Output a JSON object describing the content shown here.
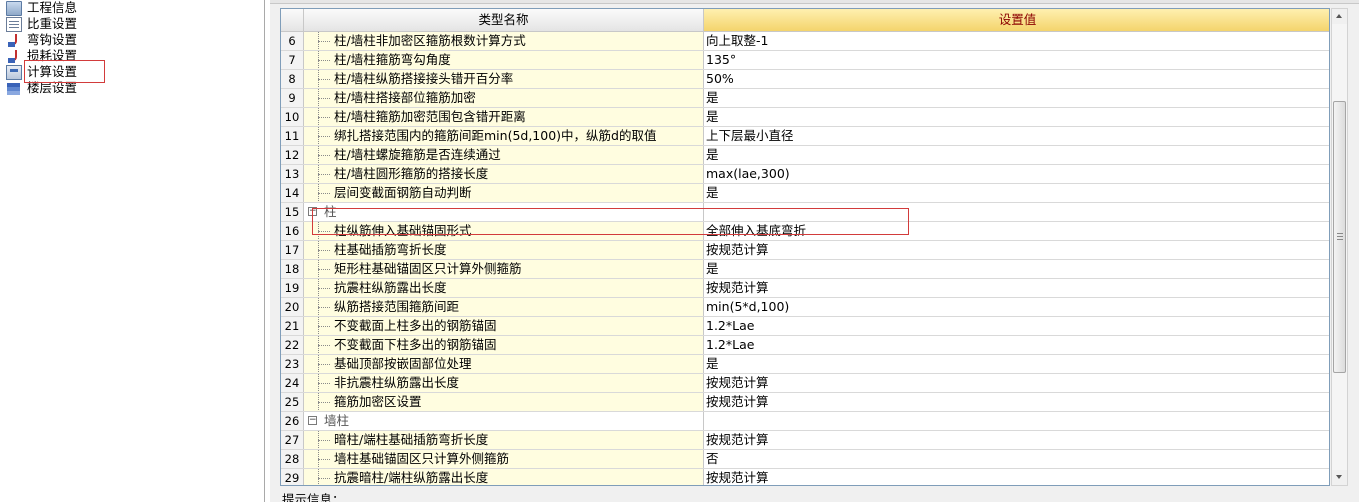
{
  "nav": {
    "items": [
      {
        "label": "工程信息",
        "icon": "folder-icon"
      },
      {
        "label": "比重设置",
        "icon": "document-icon"
      },
      {
        "label": "弯钩设置",
        "icon": "hook-icon"
      },
      {
        "label": "损耗设置",
        "icon": "chart-icon"
      },
      {
        "label": "计算设置",
        "icon": "calculator-icon"
      },
      {
        "label": "楼层设置",
        "icon": "layers-icon"
      }
    ],
    "selected": "计算设置"
  },
  "grid": {
    "columns": {
      "name": "类型名称",
      "value": "设置值"
    },
    "rows": [
      {
        "num": "6",
        "name": "柱/墙柱非加密区箍筋根数计算方式",
        "value": "向上取整-1"
      },
      {
        "num": "7",
        "name": "柱/墙柱箍筋弯勾角度",
        "value": "135°"
      },
      {
        "num": "8",
        "name": "柱/墙柱纵筋搭接接头错开百分率",
        "value": "50%"
      },
      {
        "num": "9",
        "name": "柱/墙柱搭接部位箍筋加密",
        "value": "是"
      },
      {
        "num": "10",
        "name": "柱/墙柱箍筋加密范围包含错开距离",
        "value": "是"
      },
      {
        "num": "11",
        "name": "绑扎搭接范围内的箍筋间距min(5d,100)中，纵筋d的取值",
        "value": "上下层最小直径"
      },
      {
        "num": "12",
        "name": "柱/墙柱螺旋箍筋是否连续通过",
        "value": "是"
      },
      {
        "num": "13",
        "name": "柱/墙柱圆形箍筋的搭接长度",
        "value": "max(lae,300)"
      },
      {
        "num": "14",
        "name": "层间变截面钢筋自动判断",
        "value": "是"
      },
      {
        "num": "15",
        "group": "柱",
        "expander": "−"
      },
      {
        "num": "16",
        "name": "柱纵筋伸入基础锚固形式",
        "value": "全部伸入基底弯折"
      },
      {
        "num": "17",
        "name": "柱基础插筋弯折长度",
        "value": "按规范计算"
      },
      {
        "num": "18",
        "name": "矩形柱基础锚固区只计算外侧箍筋",
        "value": "是"
      },
      {
        "num": "19",
        "name": "抗震柱纵筋露出长度",
        "value": "按规范计算"
      },
      {
        "num": "20",
        "name": "纵筋搭接范围箍筋间距",
        "value": "min(5*d,100)"
      },
      {
        "num": "21",
        "name": "不变截面上柱多出的钢筋锚固",
        "value": "1.2*Lae"
      },
      {
        "num": "22",
        "name": "不变截面下柱多出的钢筋锚固",
        "value": "1.2*Lae"
      },
      {
        "num": "23",
        "name": "基础顶部按嵌固部位处理",
        "value": "是"
      },
      {
        "num": "24",
        "name": "非抗震柱纵筋露出长度",
        "value": "按规范计算"
      },
      {
        "num": "25",
        "name": "箍筋加密区设置",
        "value": "按规范计算"
      },
      {
        "num": "26",
        "group": "墙柱",
        "expander": "−"
      },
      {
        "num": "27",
        "name": "暗柱/端柱基础插筋弯折长度",
        "value": "按规范计算"
      },
      {
        "num": "28",
        "name": "墙柱基础锚固区只计算外侧箍筋",
        "value": "否"
      },
      {
        "num": "29",
        "name": "抗震暗柱/端柱纵筋露出长度",
        "value": "按规范计算"
      }
    ]
  },
  "tip": {
    "label": "提示信息："
  },
  "colors": {
    "highlight_border": "#d23b3b",
    "header_value_bg": "#f4d46c",
    "name_cell_bg": "#fffde0"
  }
}
